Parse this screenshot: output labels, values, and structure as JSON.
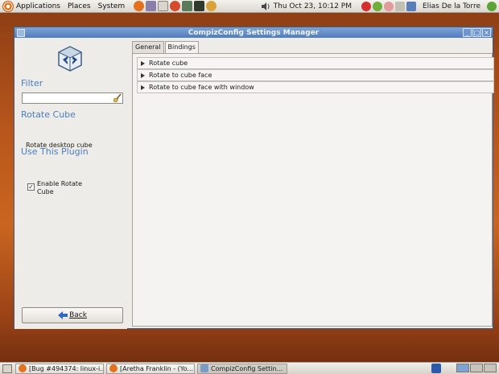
{
  "top_panel": {
    "menus": [
      "Applications",
      "Places",
      "System"
    ],
    "clock": "Thu Oct 23, 10:12 PM",
    "user_name": "Elias De la Torre"
  },
  "window": {
    "title": "CompizConfig Settings Manager"
  },
  "sidebar": {
    "filter_heading": "Filter",
    "filter_value": "",
    "plugin_heading": "Rotate Cube",
    "plugin_description": "Rotate desktop cube",
    "use_heading": "Use This Plugin",
    "enable_label": "Enable Rotate Cube",
    "enable_checked": true,
    "back_label": "Back"
  },
  "tabs": [
    {
      "label": "General",
      "active": false
    },
    {
      "label": "Bindings",
      "active": true
    }
  ],
  "bindings": [
    {
      "label": "Rotate cube"
    },
    {
      "label": "Rotate to cube face"
    },
    {
      "label": "Rotate to cube face with window"
    }
  ],
  "taskbar": {
    "tasks": [
      {
        "label": "[Bug #494374: linux-i...",
        "active": false
      },
      {
        "label": "[Aretha Franklin - (Yo...",
        "active": false
      },
      {
        "label": "CompizConfig Settin...",
        "active": true
      }
    ]
  },
  "colors": {
    "heading_blue": "#4a7ec0",
    "titlebar_blue": "#5f8ac6",
    "wallpaper_orange": "#c9651f"
  }
}
